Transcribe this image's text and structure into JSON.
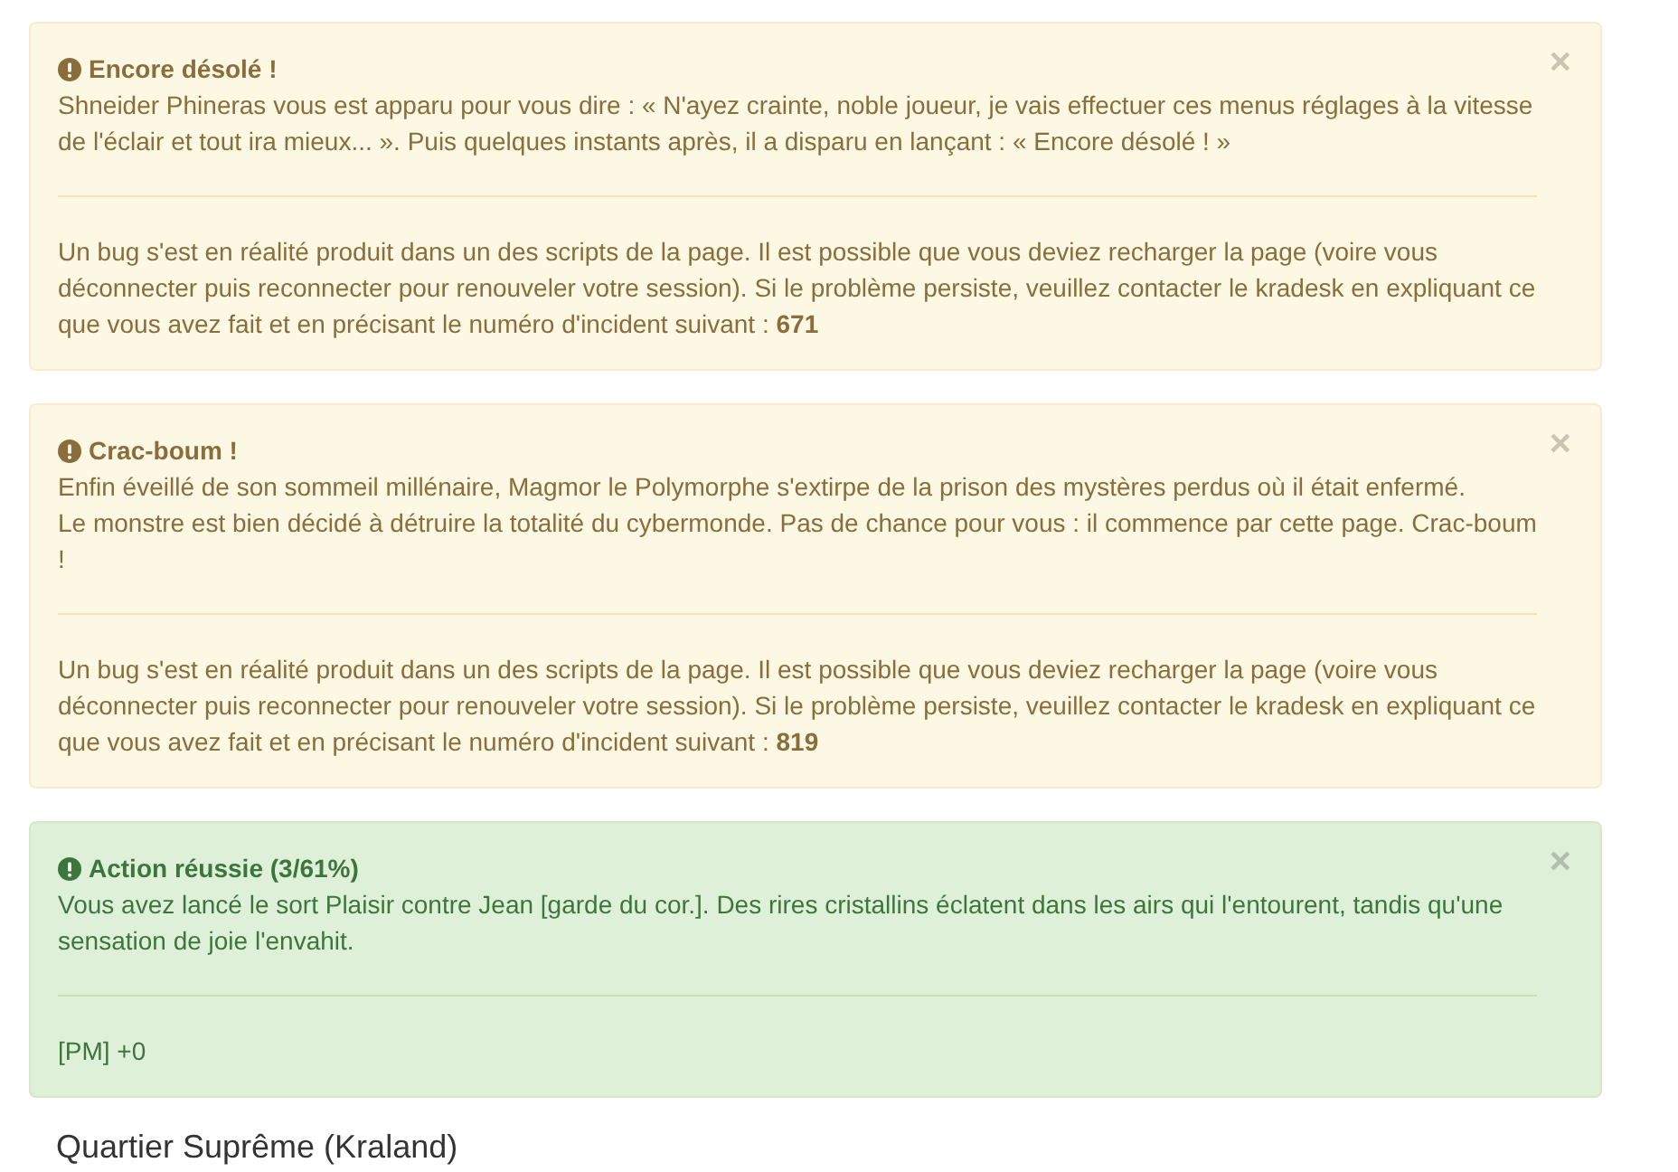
{
  "alerts": [
    {
      "kind": "warning",
      "title": "Encore désolé !",
      "lines": [
        "Shneider Phineras vous est apparu pour vous dire : « N'ayez crainte, noble joueur, je vais effectuer ces menus réglages à la vitesse de l'éclair et tout ira mieux... ». Puis quelques instants après, il a disparu en lançant : « Encore désolé ! »"
      ],
      "footer": "Un bug s'est en réalité produit dans un des scripts de la page. Il est possible que vous deviez recharger la page (voire vous déconnecter puis reconnecter pour renouveler votre session). Si le problème persiste, veuillez contacter le kradesk en expliquant ce que vous avez fait et en précisant le numéro d'incident suivant : **671**",
      "close": "×"
    },
    {
      "kind": "warning",
      "title": "Crac-boum !",
      "lines": [
        "Enfin éveillé de son sommeil millénaire, Magmor le Polymorphe s'extirpe de la prison des mystères perdus où il était enfermé.",
        "Le monstre est bien décidé à détruire la totalité du cybermonde. Pas de chance pour vous : il commence par cette page. Crac-boum !"
      ],
      "footer": "Un bug s'est en réalité produit dans un des scripts de la page. Il est possible que vous deviez recharger la page (voire vous déconnecter puis reconnecter pour renouveler votre session). Si le problème persiste, veuillez contacter le kradesk en expliquant ce que vous avez fait et en précisant le numéro d'incident suivant : **819**",
      "close": "×"
    },
    {
      "kind": "success",
      "title": "Action réussie (3/61%)",
      "lines": [
        "Vous avez lancé le sort Plaisir contre Jean [garde du cor.]. Des rires cristallins éclatent dans les airs qui l'entourent, tandis qu'une sensation de joie l'envahit."
      ],
      "footer": "[PM] +0",
      "close": "×"
    }
  ],
  "section_title": "Quartier Suprême (Kraland)"
}
